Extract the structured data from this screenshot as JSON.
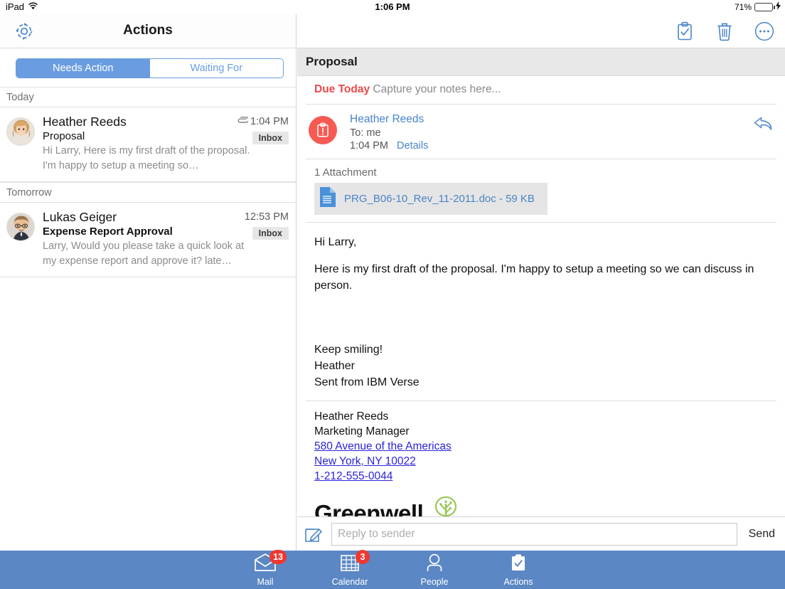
{
  "statusbar": {
    "device": "iPad",
    "wifi_icon": "wifi-icon",
    "time": "1:06 PM",
    "battery_percent": "71%",
    "battery_level": 71,
    "charging": true
  },
  "left_pane": {
    "settings_icon": "gear-icon",
    "title": "Actions",
    "segments": [
      {
        "label": "Needs Action",
        "active": true
      },
      {
        "label": "Waiting For",
        "active": false
      }
    ],
    "groups": [
      {
        "header": "Today",
        "items": [
          {
            "sender": "Heather Reeds",
            "subject": "Proposal",
            "preview": "Hi Larry, Here is my first draft of the proposal. I'm happy to setup a meeting so…",
            "time": "1:04 PM",
            "has_attachment": true,
            "folder": "Inbox",
            "subject_bold": false
          }
        ]
      },
      {
        "header": "Tomorrow",
        "items": [
          {
            "sender": "Lukas Geiger",
            "subject": "Expense Report Approval",
            "preview": "Larry, Would you please take a quick look at my expense report and approve it? late…",
            "time": "12:53 PM",
            "has_attachment": false,
            "folder": "Inbox",
            "subject_bold": true
          }
        ]
      }
    ]
  },
  "right_pane": {
    "toolbar_icons": [
      "clipboard-check-icon",
      "trash-icon",
      "more-ellipsis-icon"
    ],
    "subject": "Proposal",
    "notes": {
      "due_label": "Due Today",
      "placeholder": "Capture your notes here..."
    },
    "message_header": {
      "task_icon": "clipboard-alert-icon",
      "sender": "Heather Reeds",
      "to": "To: me",
      "time": "1:04 PM",
      "details_label": "Details",
      "reply_icon": "reply-arrow-icon"
    },
    "attachments": {
      "count_label": "1 Attachment",
      "items": [
        {
          "icon": "document-icon",
          "name": "PRG_B06-10_Rev_11-2011.doc - 59 KB"
        }
      ]
    },
    "body": {
      "greeting": "Hi Larry,",
      "paragraph": "Here is my first draft of the proposal.  I'm happy to setup a meeting so we can discuss in person.",
      "closing_1": "Keep smiling!",
      "closing_2": "Heather",
      "closing_3": "Sent from IBM Verse"
    },
    "signature": {
      "name": "Heather Reeds",
      "role": "Marketing Manager",
      "address_line1": "580 Avenue of the Americas",
      "address_line2": "New York, NY 10022",
      "phone": "1-212-555-0044",
      "company": "Greenwell",
      "logo_icon": "tree-icon"
    }
  },
  "reply_bar": {
    "compose_icon": "compose-pencil-icon",
    "placeholder": "Reply to sender",
    "value": "",
    "send_label": "Send"
  },
  "tabbar": {
    "tabs": [
      {
        "label": "Mail",
        "icon": "envelope-icon",
        "badge": "13",
        "active": false
      },
      {
        "label": "Calendar",
        "icon": "calendar-grid-icon",
        "badge": "3",
        "active": false
      },
      {
        "label": "People",
        "icon": "person-icon",
        "badge": "",
        "active": false
      },
      {
        "label": "Actions",
        "icon": "clipboard-check-icon",
        "badge": "",
        "active": true
      }
    ]
  },
  "colors": {
    "accent_blue": "#4a85c8",
    "tabbar_blue": "#5b87c4",
    "segment_blue": "#6a9de0",
    "due_red": "#f0484a",
    "task_red": "#f65a52",
    "badge_red": "#f0382f",
    "link_purple": "#2b24d8",
    "logo_green": "#9ac758",
    "battery_green": "#4cd964"
  }
}
